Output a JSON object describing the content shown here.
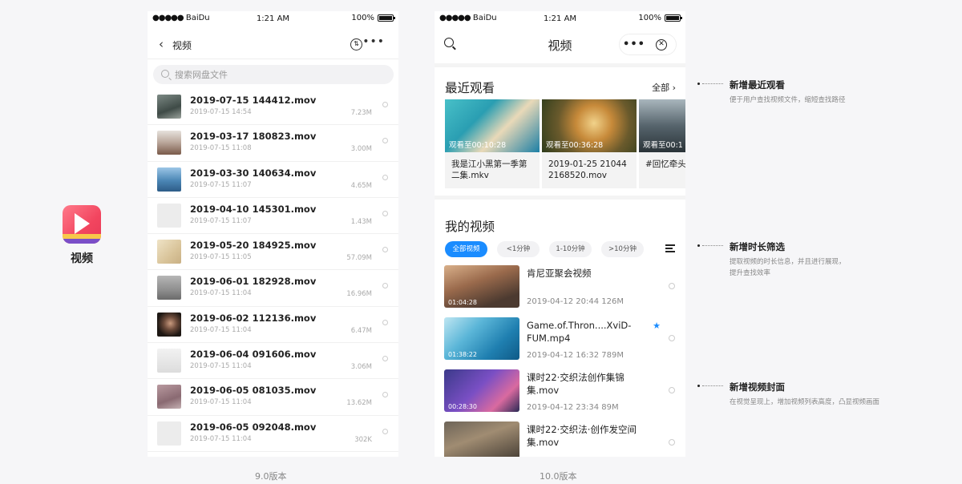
{
  "app": {
    "name": "视频"
  },
  "status_bar": {
    "carrier": "BaiDu",
    "time": "1:21 AM",
    "battery": "100%"
  },
  "v9": {
    "nav_title": "视频",
    "search_placeholder": "搜索网盘文件",
    "files": [
      {
        "name": "2019-07-15 144412.mov",
        "date": "2019-07-15 14:54",
        "size": "7.23M"
      },
      {
        "name": "2019-03-17 180823.mov",
        "date": "2019-07-15 11:08",
        "size": "3.00M"
      },
      {
        "name": "2019-03-30 140634.mov",
        "date": "2019-07-15 11:07",
        "size": "4.65M"
      },
      {
        "name": "2019-04-10 145301.mov",
        "date": "2019-07-15 11:07",
        "size": "1.43M"
      },
      {
        "name": "2019-05-20 184925.mov",
        "date": "2019-07-15 11:05",
        "size": "57.09M"
      },
      {
        "name": "2019-06-01 182928.mov",
        "date": "2019-07-15 11:04",
        "size": "16.96M"
      },
      {
        "name": "2019-06-02 112136.mov",
        "date": "2019-07-15 11:04",
        "size": "6.47M"
      },
      {
        "name": "2019-06-04 091606.mov",
        "date": "2019-07-15 11:04",
        "size": "3.06M"
      },
      {
        "name": "2019-06-05 081035.mov",
        "date": "2019-07-15 11:04",
        "size": "13.62M"
      },
      {
        "name": "2019-06-05 092048.mov",
        "date": "2019-07-15 11:04",
        "size": "302K"
      }
    ],
    "version_label": "9.0版本"
  },
  "v10": {
    "nav_title": "视频",
    "recent_title": "最近观看",
    "all_label": "全部",
    "recent": [
      {
        "progress": "观看至00:10:28",
        "caption": "我是江小黑第一季第二集.mkv"
      },
      {
        "progress": "观看至00:36:28",
        "caption": "2019-01-25 21044 2168520.mov"
      },
      {
        "progress": "观看至00:1",
        "caption": "#回忆牵头 mkv"
      }
    ],
    "my_videos_title": "我的视频",
    "chips": [
      "全部视频",
      "<1分钟",
      "1-10分钟",
      ">10分钟"
    ],
    "videos": [
      {
        "title": "肯尼亚聚会视频",
        "duration": "01:04:28",
        "meta": "2019-04-12  20:44  126M"
      },
      {
        "title": "Game.of.Thron....XviD-FUM.mp4",
        "duration": "01:38:22",
        "meta": "2019-04-12  16:32  789M"
      },
      {
        "title": "课时22·交织法创作集锦集.mov",
        "duration": "00:28:30",
        "meta": "2019-04-12  23:34  89M"
      },
      {
        "title": "课时22·交织法·创作发空间集.mov",
        "duration": "",
        "meta": ""
      }
    ],
    "version_label": "10.0版本"
  },
  "annotations": [
    {
      "title": "新增最近观看",
      "desc": [
        "便于用户查找视频文件，缩短查找路径"
      ]
    },
    {
      "title": "新增时长筛选",
      "desc": [
        "提取视频的时长信息，并且进行展现，",
        "提升查找效率"
      ]
    },
    {
      "title": "新增视频封面",
      "desc": [
        "在视觉呈现上，增加视频列表高度，凸显视频画面"
      ]
    }
  ],
  "colors": {
    "accent": "#1a8cff",
    "app_icon": "#f2455f"
  },
  "icons": [
    "back-icon",
    "filter-icon",
    "more-icon",
    "search-icon",
    "close-icon",
    "chevron-right-icon",
    "sort-icon",
    "star-icon"
  ]
}
